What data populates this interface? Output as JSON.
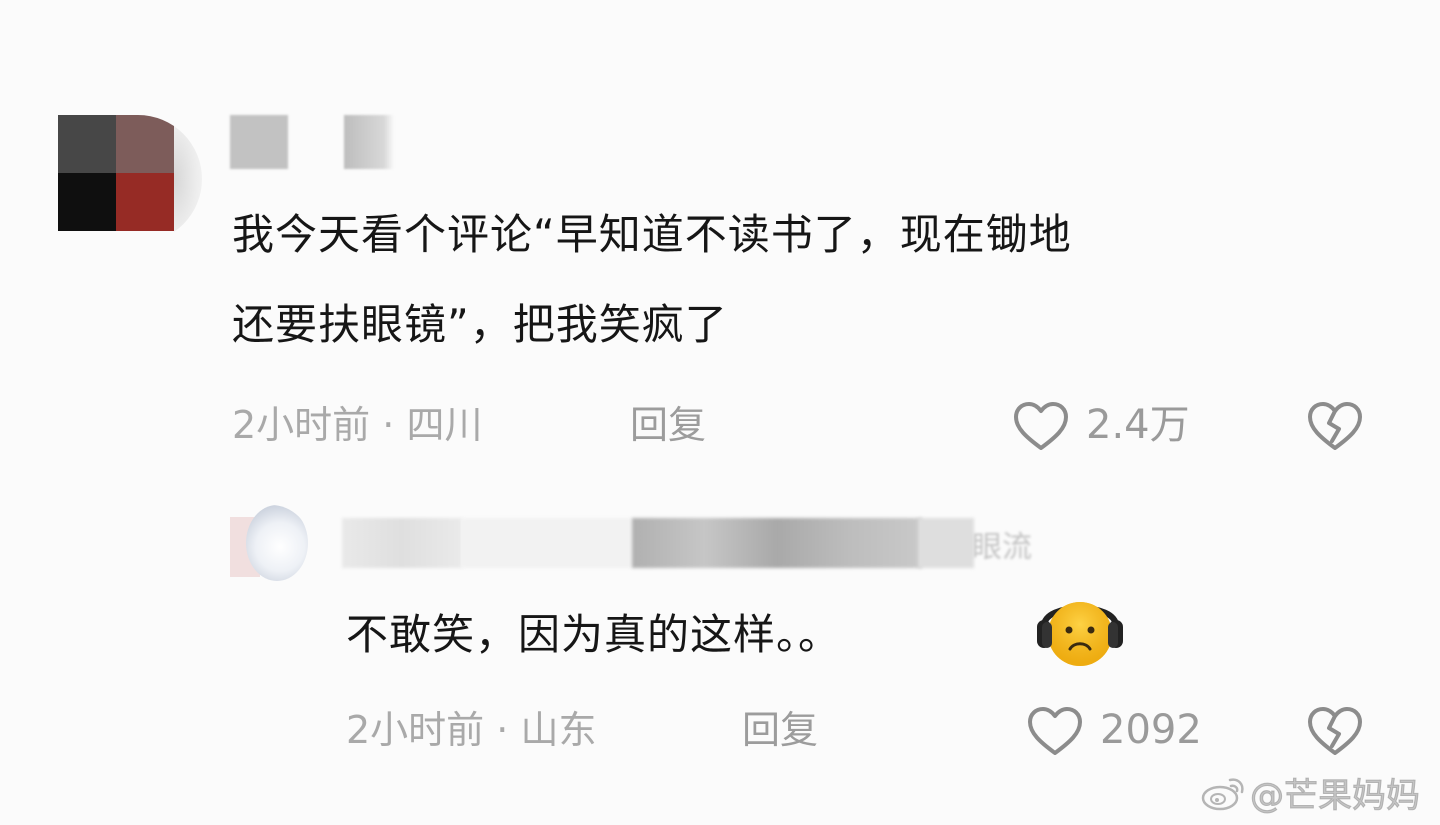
{
  "main_comment": {
    "text_line_1": "我今天看个评论“早知道不读书了，现在锄地",
    "text_line_2": "还要扶眼镜”，把我笑疯了",
    "time": "2小时前",
    "separator": "·",
    "location": "四川",
    "reply_label": "回复",
    "like_count": "2.4万",
    "like_icon": "heart-outline-icon",
    "dislike_icon": "broken-heart-icon"
  },
  "reply_comment": {
    "name_fragment": "眼流",
    "text": "不敢笑，因为真的这样。。",
    "emoji": "headphones-frowning-face-emoji",
    "time": "2小时前",
    "separator": "·",
    "location": "山东",
    "reply_label": "回复",
    "like_count": "2092",
    "like_icon": "heart-outline-icon",
    "dislike_icon": "broken-heart-icon"
  },
  "watermark": {
    "logo": "weibo-logo",
    "text": "@芒果妈妈"
  },
  "colors": {
    "background": "#fbfbfb",
    "text": "#161616",
    "meta": "#a9a9a9",
    "emoji_yellow": "#f5b818"
  }
}
